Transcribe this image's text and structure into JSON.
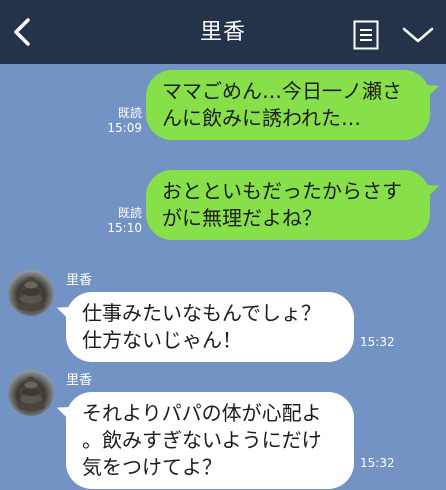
{
  "header": {
    "title": "里香"
  },
  "messages": [
    {
      "lines": [
        "ママごめん…今日一ノ瀬さ",
        "んに飲みに誘われた…"
      ],
      "read": "既読",
      "time": "15:09"
    },
    {
      "lines": [
        "おとといもだったからさす",
        "がに無理だよね？"
      ],
      "read": "既読",
      "time": "15:10"
    },
    {
      "sender": "里香",
      "lines": [
        "仕事みたいなもんでしょ？",
        "仕方ないじゃん！"
      ],
      "time": "15:32"
    },
    {
      "sender": "里香",
      "lines": [
        "それよりパパの体が心配よ",
        "。飲みすぎないようにだけ",
        "気をつけてよ？"
      ],
      "time": "15:32"
    }
  ],
  "icons": {
    "back": "chevron-left-icon",
    "note": "note-icon",
    "menu": "chevron-down-icon"
  },
  "colors": {
    "header_bg": "#243349",
    "chat_bg": "#7393c4",
    "outgoing_bubble": "#87df4a",
    "incoming_bubble": "#ffffff"
  }
}
